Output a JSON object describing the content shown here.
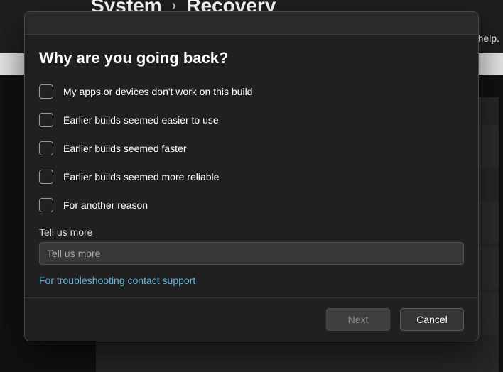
{
  "breadcrumb": {
    "parent": "System",
    "current": "Recovery"
  },
  "help_fragment": "help.",
  "dialog": {
    "title": "Why are you going back?",
    "options": [
      "My apps or devices don't work on this build",
      "Earlier builds seemed easier to use",
      "Earlier builds seemed faster",
      "Earlier builds seemed more reliable",
      "For another reason"
    ],
    "tell_us_more_label": "Tell us more",
    "tell_us_more_placeholder": "Tell us more",
    "support_link": "For troubleshooting contact support",
    "buttons": {
      "next": "Next",
      "cancel": "Cancel"
    }
  }
}
